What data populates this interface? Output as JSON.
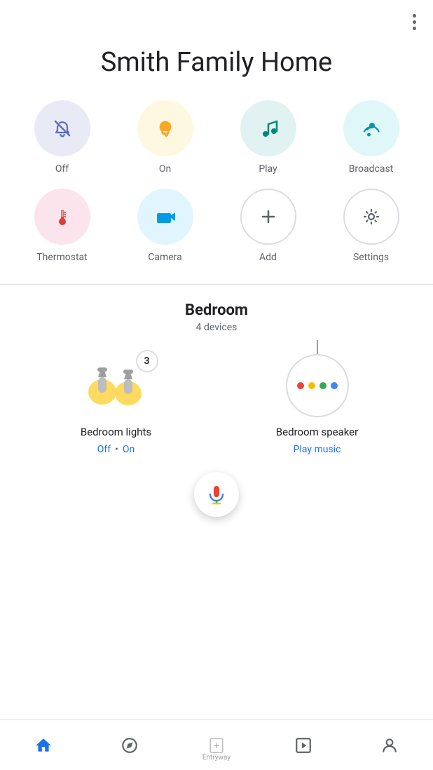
{
  "app": {
    "title": "Smith Family Home",
    "more_button_label": "More options"
  },
  "quick_actions": [
    {
      "id": "off",
      "label": "Off",
      "circle_class": "circle-off"
    },
    {
      "id": "on",
      "label": "On",
      "circle_class": "circle-on"
    },
    {
      "id": "play",
      "label": "Play",
      "circle_class": "circle-play"
    },
    {
      "id": "broadcast",
      "label": "Broadcast",
      "circle_class": "circle-broadcast"
    },
    {
      "id": "thermostat",
      "label": "Thermostat",
      "circle_class": "circle-thermostat"
    },
    {
      "id": "camera",
      "label": "Camera",
      "circle_class": "circle-camera"
    },
    {
      "id": "add",
      "label": "Add",
      "circle_class": "circle-add"
    },
    {
      "id": "settings",
      "label": "Settings",
      "circle_class": "circle-settings"
    }
  ],
  "room": {
    "name": "Bedroom",
    "device_count": "4 devices"
  },
  "devices": [
    {
      "id": "bedroom-lights",
      "name": "Bedroom lights",
      "badge": "3",
      "status_off": "Off",
      "status_dot": "•",
      "status_on": "On"
    },
    {
      "id": "bedroom-speaker",
      "name": "Bedroom speaker",
      "action": "Play music"
    }
  ],
  "bottom_nav": [
    {
      "id": "home",
      "label": "Home",
      "active": true
    },
    {
      "id": "explore",
      "label": "",
      "active": false
    },
    {
      "id": "entryway",
      "label": "Entryway",
      "active": false
    },
    {
      "id": "media",
      "label": "",
      "active": false
    },
    {
      "id": "profile",
      "label": "",
      "active": false
    }
  ],
  "colors": {
    "blue": "#1a73e8",
    "off_circle": "#e8eaf6",
    "on_circle": "#fff8e1",
    "play_circle": "#e0f2f1",
    "broadcast_circle": "#e0f7fa",
    "thermostat_circle": "#fce4ec",
    "camera_circle": "#e1f5fe"
  }
}
